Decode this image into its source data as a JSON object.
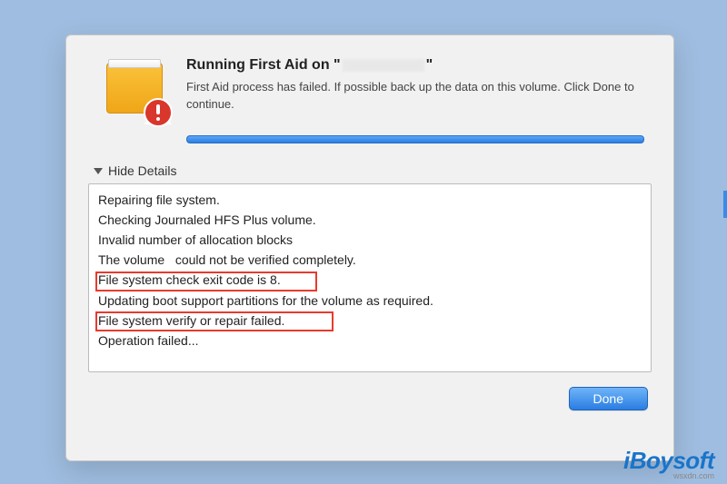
{
  "dialog": {
    "title_prefix": "Running First Aid on \"",
    "title_suffix": "\"",
    "subtitle": "First Aid process has failed. If possible back up the data on this volume. Click Done to continue.",
    "details_toggle": "Hide Details",
    "done_label": "Done"
  },
  "log": {
    "lines": [
      "Repairing file system.",
      "Checking Journaled HFS Plus volume.",
      "Invalid number of allocation blocks",
      "The volume   could not be verified completely.",
      "File system check exit code is 8.",
      "Updating boot support partitions for the volume as required.",
      "File system verify or repair failed.",
      "Operation failed..."
    ]
  },
  "icons": {
    "disk": "disk-icon",
    "alert": "alert-icon",
    "triangle": "disclosure-triangle-icon"
  },
  "watermark": {
    "brand": "iBoysoft",
    "sub": "wsxdn.com"
  }
}
